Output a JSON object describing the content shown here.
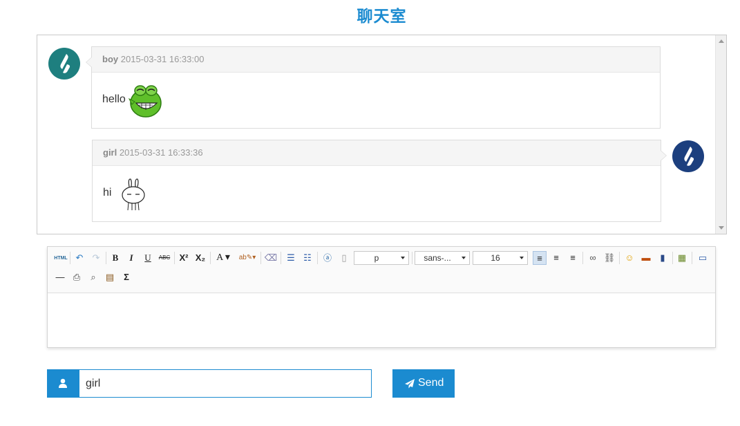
{
  "page": {
    "title": "聊天室"
  },
  "messages": [
    {
      "user": "boy",
      "time": "2015-03-31 16:33:00",
      "text": "hello",
      "emoji": "green-frog-emoji",
      "side": "left",
      "avatar_color": "#1e7f7f"
    },
    {
      "user": "girl",
      "time": "2015-03-31 16:33:36",
      "text": "hi",
      "emoji": "rabbit-emoji",
      "side": "right",
      "avatar_color": "#1c3f7e"
    }
  ],
  "editor": {
    "toolbar": {
      "html_label": "HTML",
      "paragraph_value": "p",
      "font_family_value": "sans-...",
      "font_size_value": "16"
    }
  },
  "form": {
    "name_value": "girl",
    "send_label": "Send"
  },
  "colors": {
    "accent": "#1b8bd0",
    "teal_avatar": "#1e7f7f",
    "navy_avatar": "#1c3f7e"
  }
}
